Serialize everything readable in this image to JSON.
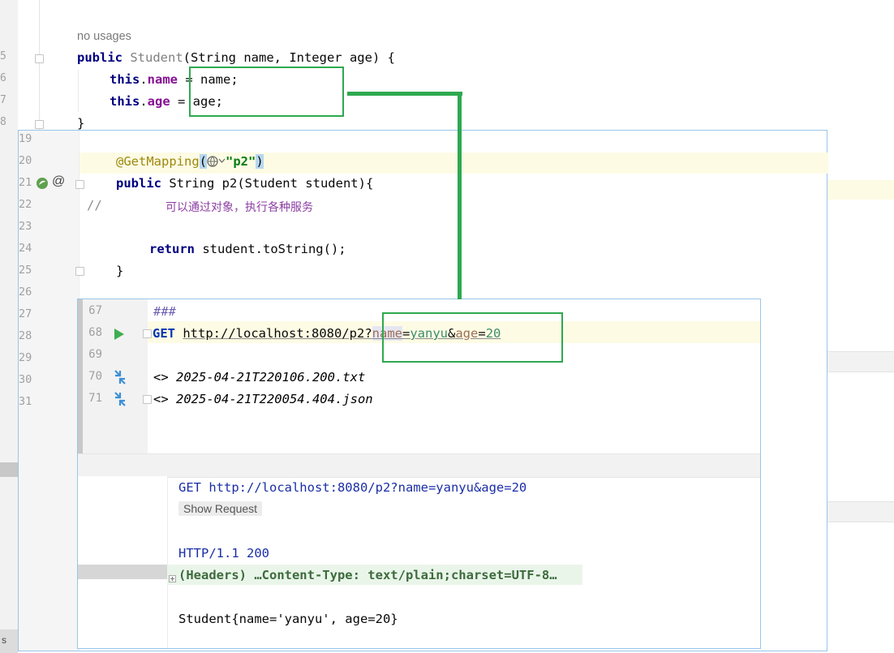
{
  "background_editor": {
    "line_numbers": [
      "5",
      "6",
      "7",
      "8",
      "9",
      "0",
      "1",
      "2",
      "3",
      "4",
      "5",
      "6",
      "7",
      "8",
      "9",
      "0",
      "1"
    ],
    "usage_hint": "no usages",
    "constructor_line": {
      "kw": "public",
      "name": "Student",
      "params": "(String name, Integer age) {"
    },
    "assign_name": {
      "this": "this",
      "dot": ".",
      "field": "name",
      "rest": " = name;"
    },
    "assign_age": {
      "this": "this",
      "dot": ".",
      "field": "age",
      "rest": " = age;"
    },
    "close_brace": "}"
  },
  "controller_popup": {
    "line_numbers": [
      "19",
      "20",
      "21",
      "22",
      "23",
      "24",
      "25",
      "26",
      "27",
      "28",
      "29",
      "30",
      "31"
    ],
    "annotation": "@GetMapping",
    "annotation_open": "(",
    "annotation_arg": "\"p2\"",
    "annotation_close": ")",
    "method_kw": "public",
    "method_sig": " String p2(Student student){",
    "comment_slashes": "//",
    "comment_text": "可以通过对象，执行各种服务",
    "return_kw": "return",
    "return_expr": " student.toString();",
    "close_brace": "}",
    "at_symbol": "@"
  },
  "http_popup": {
    "line_numbers": [
      "67",
      "68",
      "69",
      "70",
      "71"
    ],
    "separator": "###",
    "method": "GET",
    "url_base": "http://localhost:8080/p2",
    "q_mark": "?",
    "param1_name": "name",
    "param1_value": "yanyu",
    "amp": "&",
    "param2_name": "age",
    "param2_value": "20",
    "history_1": "<> 2025-04-21T220106.200.txt",
    "history_2": "<> 2025-04-21T220054.404.json"
  },
  "response": {
    "request_line": "GET http://localhost:8080/p2?name=yanyu&age=20",
    "show_request_label": "Show Request",
    "status_line": "HTTP/1.1 200",
    "headers_line": "(Headers) …Content-Type: text/plain;charset=UTF-8…",
    "body": "Student{name='yanyu', age=20}"
  },
  "bottom_left_tab": "s",
  "colors": {
    "annotation_green": "#2da94f",
    "popup_border": "#99c5ea",
    "keyword": "#0033b3",
    "field": "#871094",
    "string": "#067d17"
  }
}
